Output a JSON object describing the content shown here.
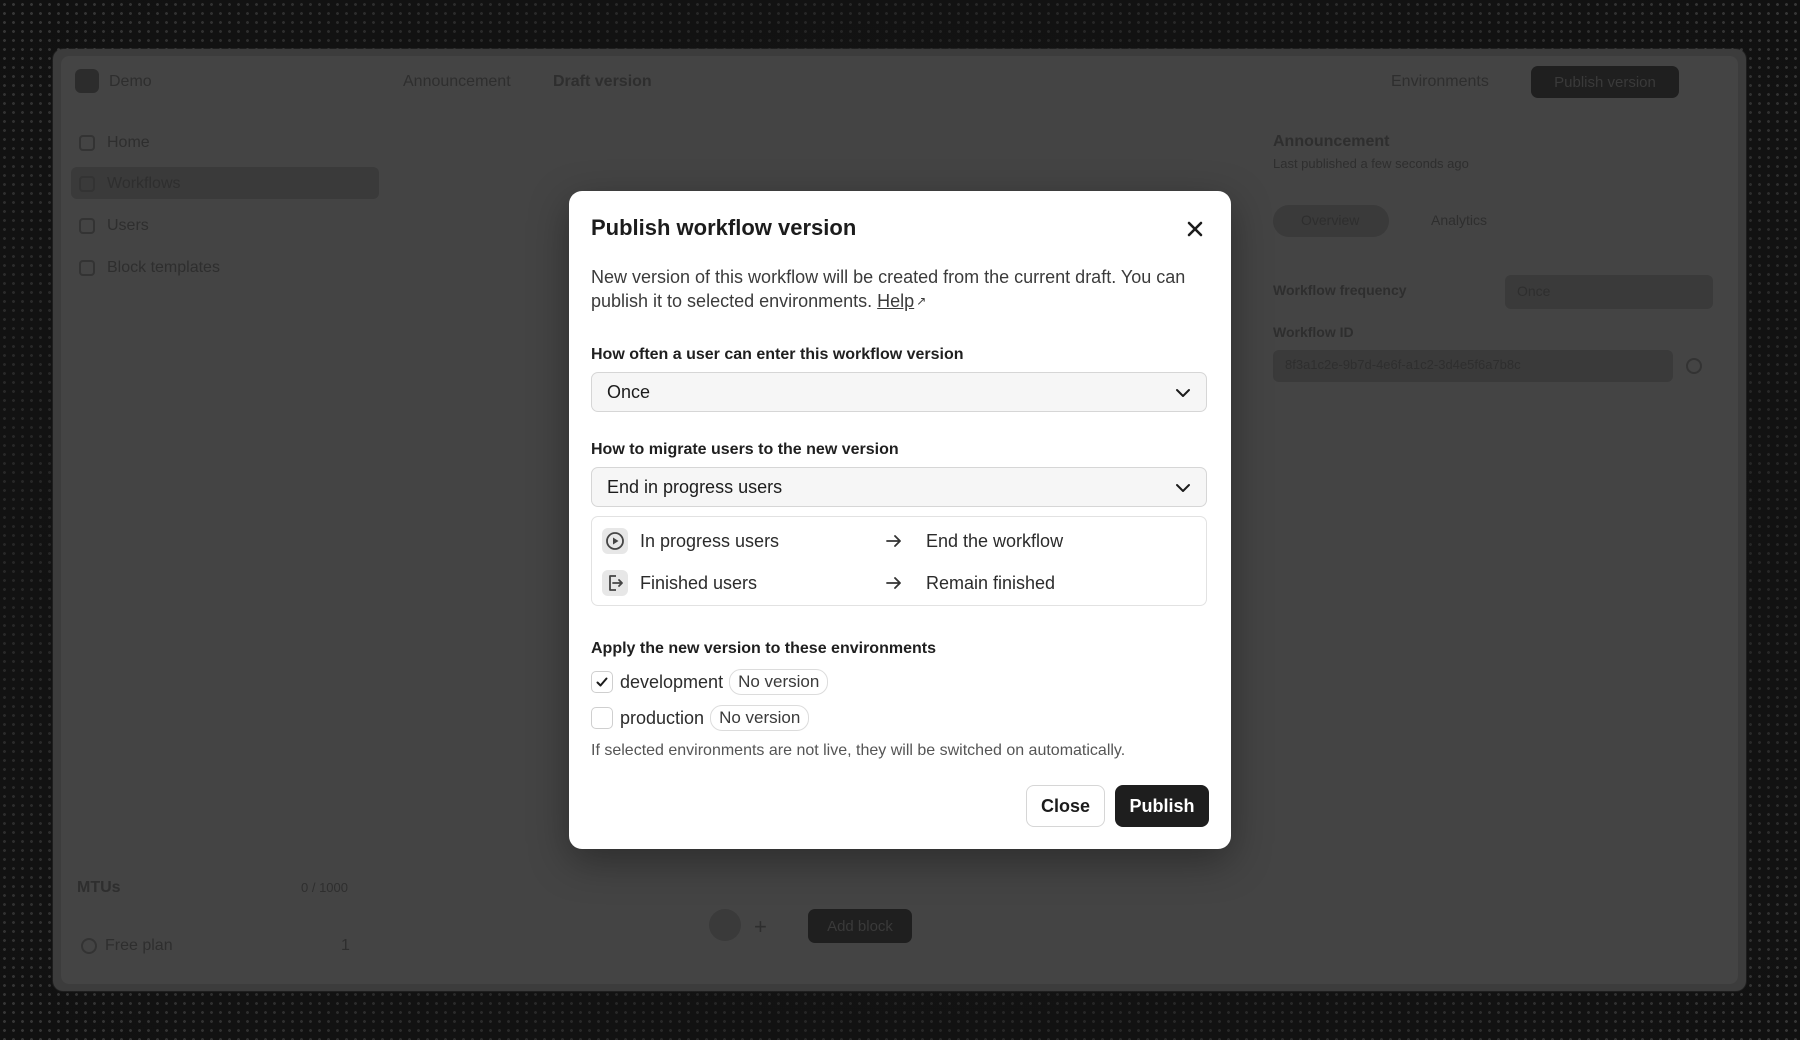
{
  "background_app": {
    "workspace": "Demo",
    "sidebar": [
      "Home",
      "Workflows",
      "Users",
      "Block templates"
    ],
    "breadcrumb": [
      "Announcement",
      "Draft version"
    ],
    "header_buttons": [
      "Environments",
      "Publish version"
    ],
    "panel_title": "Announcement",
    "panel_subtitle": "Last published a few seconds ago",
    "panel_tabs": [
      "Overview",
      "Analytics"
    ],
    "panel_field_label": "Workflow frequency",
    "panel_field_value": "Once",
    "panel_id_label": "Workflow ID",
    "panel_id_value": "8f3a1c2e-9b7d-4e6f-a1c2-3d4e5f6a7b8c",
    "footer_label": "MTUs",
    "footer_value": "0 / 1000",
    "footer_item": "Free plan",
    "footer_item_count": "1",
    "canvas_button": "Add block"
  },
  "modal": {
    "title": "Publish workflow version",
    "description": "New version of this workflow will be created from the current draft. You can publish it to selected environments.",
    "help_link": "Help",
    "frequency": {
      "label": "How often a user can enter this workflow version",
      "value": "Once"
    },
    "migration": {
      "label": "How to migrate users to the new version",
      "value": "End in progress users",
      "rows": [
        {
          "icon": "play-circle-icon",
          "from": "In progress users",
          "to": "End the workflow"
        },
        {
          "icon": "exit-door-icon",
          "from": "Finished users",
          "to": "Remain finished"
        }
      ]
    },
    "environments": {
      "label": "Apply the new version to these environments",
      "items": [
        {
          "name": "development",
          "checked": true,
          "badge": "No version"
        },
        {
          "name": "production",
          "checked": false,
          "badge": "No version"
        }
      ],
      "note": "If selected environments are not live, they will be switched on automatically."
    },
    "buttons": {
      "close": "Close",
      "publish": "Publish"
    }
  },
  "colors": {
    "primary_button": "#1e1e1e",
    "overlay": "#444444",
    "modal_bg": "#ffffff"
  }
}
